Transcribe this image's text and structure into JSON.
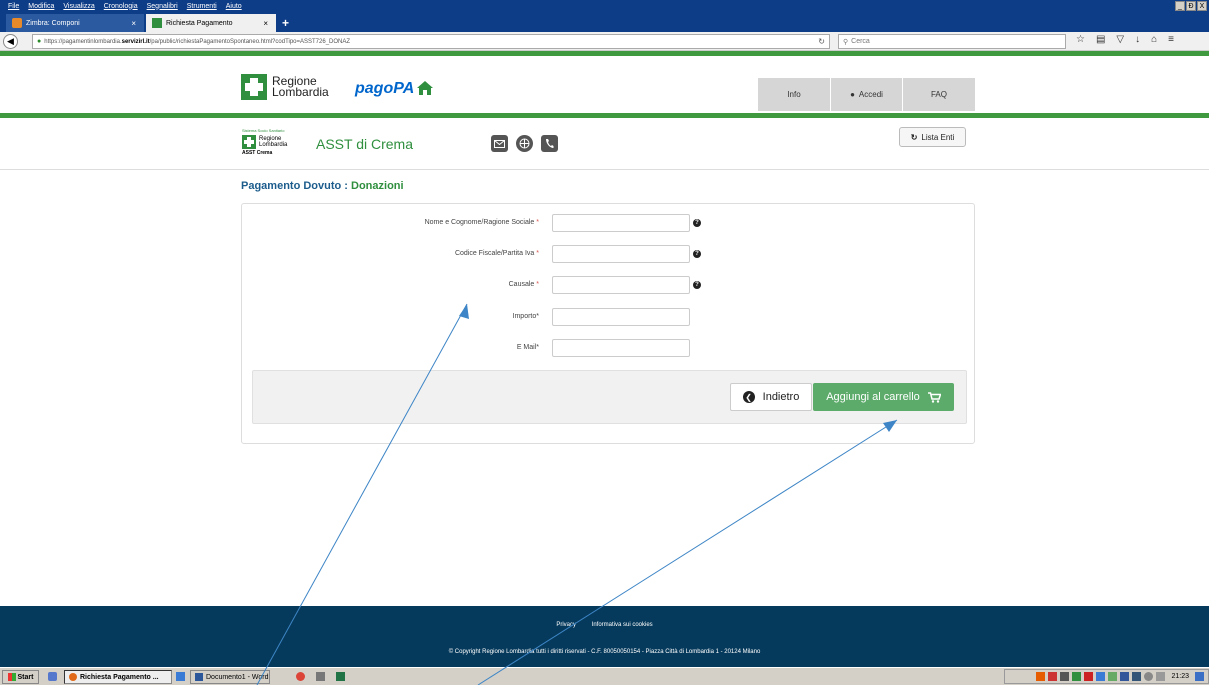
{
  "browser": {
    "menu": [
      "File",
      "Modifica",
      "Visualizza",
      "Cronologia",
      "Segnalibri",
      "Strumenti",
      "Aiuto"
    ],
    "window_controls": [
      "_",
      "Ɖ",
      "X"
    ],
    "tabs": [
      {
        "label": "Zimbra: Componi",
        "close": "×"
      },
      {
        "label": "Richiesta Pagamento",
        "close": "×"
      }
    ],
    "newtab": "+",
    "url_prefix": "https://pagamentinlombardia.",
    "url_domain": "servizirl.it",
    "url_path": "/pa/public/richiestaPagamentoSpontaneo.html?codTipo=ASST726_DONAZ",
    "search_placeholder": "Cerca"
  },
  "header": {
    "logo_line1": "Regione",
    "logo_line2": "Lombardia",
    "pagopa": "pagoPA",
    "nav": {
      "info": "Info",
      "accedi": "Accedi",
      "faq": "FAQ"
    }
  },
  "entity": {
    "small": "Sistema Socio Sanitario",
    "rl1": "Regione",
    "rl2": "Lombardia",
    "asst": "ASST Crema",
    "name": "ASST di Crema",
    "lista": "Lista Enti"
  },
  "page": {
    "title_prefix": "Pagamento Dovuto : ",
    "title_suffix": "Donazioni"
  },
  "form": {
    "fields": [
      {
        "label": "Nome e Cognome/Ragione Sociale",
        "req": "*",
        "value": ""
      },
      {
        "label": "Codice Fiscale/Partita Iva",
        "req": "*",
        "value": ""
      },
      {
        "label": "Causale",
        "req": "*",
        "value": ""
      },
      {
        "label": "Importo*",
        "req": "",
        "value": ""
      },
      {
        "label": "E Mail*",
        "req": "",
        "value": ""
      }
    ],
    "help": "?",
    "back_label": "Indietro",
    "cart_label": "Aggiungi al carrello"
  },
  "footer": {
    "privacy": "Privacy",
    "cookies": "Informativa sui cookies",
    "copyright": "© Copyright Regione Lombardia tutti i diritti riservati - C.F. 80050050154 - Piazza Città di Lombardia 1 - 20124 Milano"
  },
  "taskbar": {
    "start": "Start",
    "active_item": "Richiesta Pagamento ...",
    "word_item": "Documento1 - Word",
    "clock": "21:23"
  },
  "colors": {
    "brand_green": "#2f8f3e",
    "title_blue": "#1c5c8c",
    "footer_bg": "#063a5c",
    "cart_btn": "#5cab6a",
    "arrow": "#3d85c6"
  }
}
